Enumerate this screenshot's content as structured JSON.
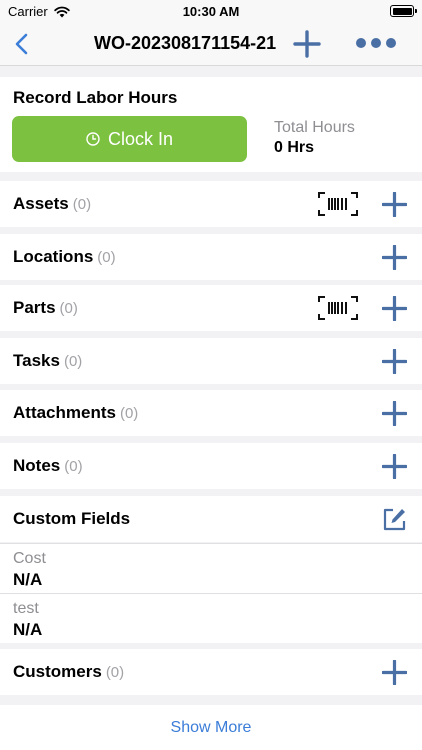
{
  "status_bar": {
    "carrier": "Carrier",
    "time": "10:30 AM"
  },
  "nav": {
    "title": "WO-202308171154-21",
    "back_icon": "chevron-left-icon",
    "add_icon": "plus-icon",
    "more_icon": "more-dots-icon"
  },
  "labor": {
    "heading": "Record Labor Hours",
    "clock_in_label": "Clock In",
    "total_label": "Total Hours",
    "total_value": "0 Hrs"
  },
  "sections": {
    "assets": {
      "label": "Assets",
      "count": "(0)"
    },
    "locations": {
      "label": "Locations",
      "count": "(0)"
    },
    "parts": {
      "label": "Parts",
      "count": "(0)"
    },
    "tasks": {
      "label": "Tasks",
      "count": "(0)"
    },
    "attachments": {
      "label": "Attachments",
      "count": "(0)"
    },
    "notes": {
      "label": "Notes",
      "count": "(0)"
    },
    "custom_fields": {
      "label": "Custom Fields"
    },
    "customers": {
      "label": "Customers",
      "count": "(0)"
    }
  },
  "custom_fields": [
    {
      "label": "Cost",
      "value": "N/A"
    },
    {
      "label": "test",
      "value": "N/A"
    }
  ],
  "show_more": "Show More",
  "colors": {
    "accent": "#4a6fa5",
    "clock_in": "#7cc13f",
    "link": "#3b7dd8"
  }
}
